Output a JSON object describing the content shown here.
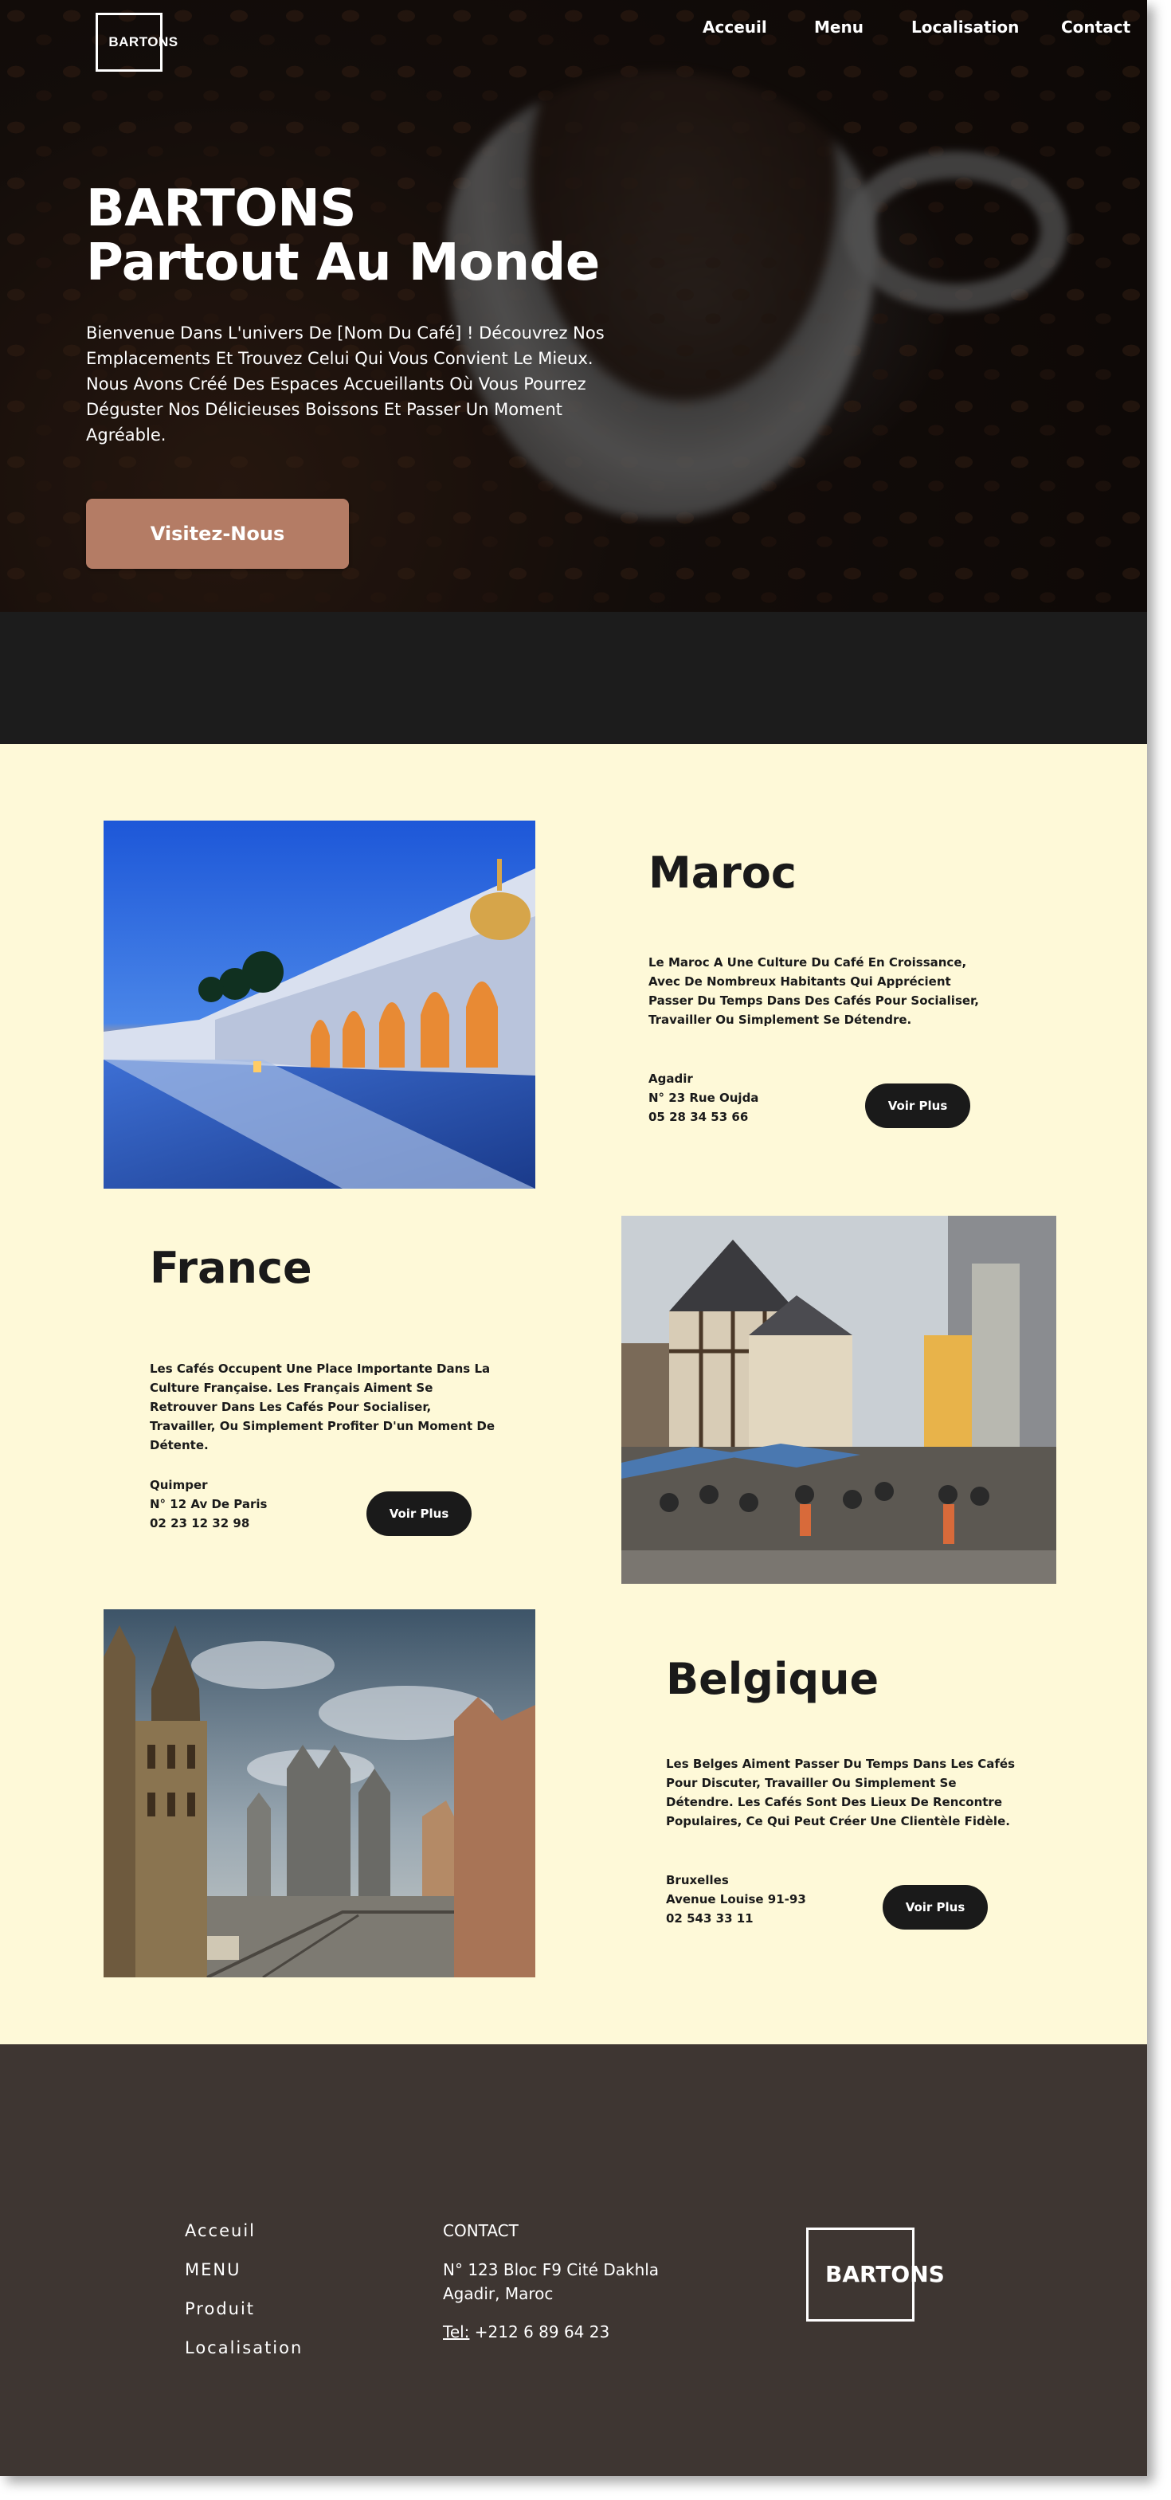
{
  "brand": {
    "logo": "BARTONS"
  },
  "nav": {
    "items": [
      {
        "label": "Acceuil"
      },
      {
        "label": "Menu"
      },
      {
        "label": "Localisation"
      },
      {
        "label": "Contact"
      }
    ]
  },
  "hero": {
    "title_line1": "BARTONS",
    "title_line2": "Partout Au Monde",
    "text": "Bienvenue Dans L'univers De [Nom Du Café] ! Découvrez Nos Emplacements Et Trouvez Celui Qui Vous Convient Le Mieux. Nous Avons Créé Des Espaces Accueillants Où Vous Pourrez Déguster Nos Délicieuses Boissons Et Passer Un Moment Agréable.",
    "button_label": "Visitez-Nous"
  },
  "locations": [
    {
      "title": "Maroc",
      "description": "Le Maroc A Une Culture Du Café En Croissance, Avec De Nombreux Habitants Qui Apprécient Passer Du Temps Dans Des Cafés Pour Socialiser, Travailler Ou Simplement Se Détendre.",
      "city": "Agadir",
      "address": "N° 23 Rue Oujda",
      "phone": "05 28 34 53 66",
      "button_label": "Voir Plus"
    },
    {
      "title": "France",
      "description": "Les Cafés Occupent Une Place Importante Dans La Culture Française. Les Français Aiment Se Retrouver Dans Les Cafés Pour Socialiser, Travailler, Ou Simplement Profiter D'un Moment De Détente.",
      "city": "Quimper",
      "address": "N° 12 Av De Paris",
      "phone": "02 23 12 32 98",
      "button_label": "Voir Plus"
    },
    {
      "title": "Belgique",
      "description": "Les Belges Aiment Passer Du Temps Dans Les Cafés Pour Discuter, Travailler Ou Simplement Se Détendre. Les Cafés Sont Des Lieux De Rencontre Populaires, Ce Qui Peut Créer Une Clientèle Fidèle.",
      "city": "Bruxelles",
      "address": "Avenue Louise 91-93",
      "phone": "02 543 33 11",
      "button_label": "Voir Plus"
    }
  ],
  "footer": {
    "links": [
      {
        "label": "Acceuil"
      },
      {
        "label": "MENU"
      },
      {
        "label": "Produit"
      },
      {
        "label": "Localisation"
      }
    ],
    "contact_heading": "CONTACT",
    "address_line1": "N° 123 Bloc F9 Cité Dakhla",
    "address_line2": "Agadir, Maroc",
    "tel_label": "Tel:",
    "tel_number": "+212 6 89 64 23",
    "logo": "BARTONS"
  },
  "colors": {
    "accent_button": "#b47c65",
    "cream_background": "#fef9d8",
    "footer_background": "#3e3632",
    "dark_band": "#1c1c1c"
  }
}
